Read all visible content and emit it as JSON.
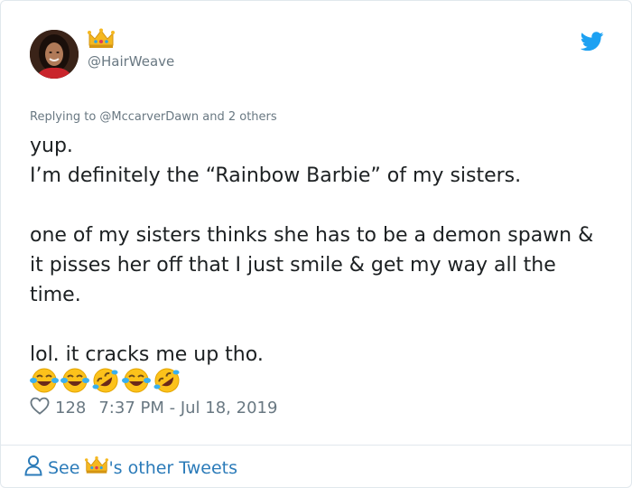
{
  "tweet": {
    "handle": "@HairWeave",
    "replying_text": "Replying to @MccarverDawn and 2 others",
    "text": "yup.\nI’m definitely the “Rainbow Barbie” of my sisters.\n\none of my sisters thinks she has to be a demon spawn & it pisses her off that I just smile & get my way all the time.\n\nlol. it cracks me up tho.",
    "emojis": [
      "face-with-tears-of-joy",
      "face-with-tears-of-joy",
      "rolling-on-floor-laughing",
      "face-with-tears-of-joy",
      "rolling-on-floor-laughing"
    ],
    "like_count": "128",
    "timestamp": "7:37 PM - Jul 18, 2019"
  },
  "footer": {
    "see_label": "See",
    "other_tweets_label": "'s other Tweets"
  },
  "colors": {
    "link": "#2b7bb9",
    "twitter_blue": "#1da1f2",
    "muted": "#697882",
    "text": "#1c2022"
  }
}
